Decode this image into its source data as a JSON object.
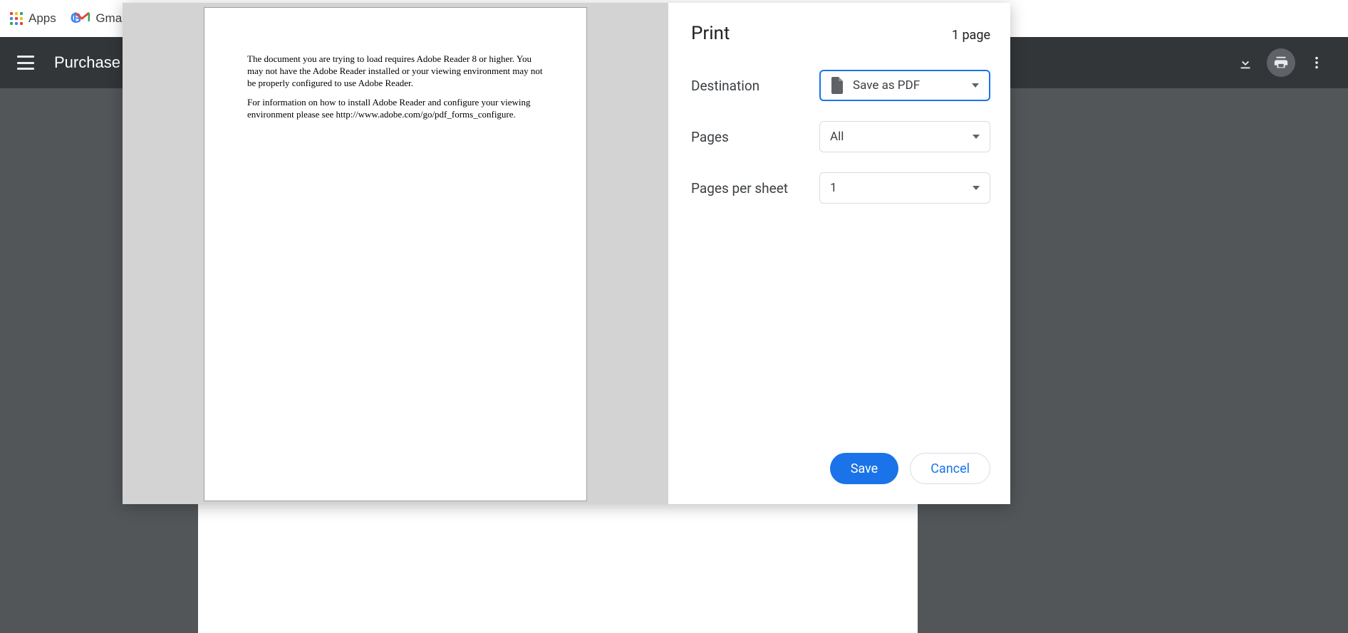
{
  "bookmarks": {
    "apps_label": "Apps",
    "gmail_label": "Gmail"
  },
  "pdf_viewer": {
    "title": "Purchase Or"
  },
  "preview": {
    "para1": "The document you are trying to load requires Adobe Reader 8 or higher. You may not have the Adobe Reader installed or your viewing environment may not be properly configured to use Adobe Reader.",
    "para2": "For information on how to install Adobe Reader and configure your viewing environment please see  http://www.adobe.com/go/pdf_forms_configure."
  },
  "print": {
    "title": "Print",
    "page_count": "1 page",
    "destination_label": "Destination",
    "destination_value": "Save as PDF",
    "pages_label": "Pages",
    "pages_value": "All",
    "pps_label": "Pages per sheet",
    "pps_value": "1",
    "save_label": "Save",
    "cancel_label": "Cancel"
  }
}
